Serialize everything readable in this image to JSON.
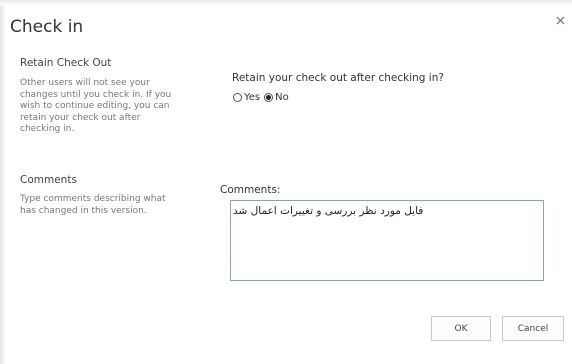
{
  "dialog": {
    "title": "Check in",
    "close_icon": "close-icon"
  },
  "retain_section": {
    "title": "Retain Check Out",
    "description_lines": [
      "Other users will not see your",
      "changes until you check in. If you",
      "wish to continue editing, you can",
      "retain your check out after",
      "checking in."
    ],
    "question": "Retain your check out after checking in?",
    "options": [
      {
        "label": "Yes",
        "selected": false
      },
      {
        "label": "No",
        "selected": true
      }
    ]
  },
  "comments_section": {
    "title": "Comments",
    "description_lines": [
      "Type comments describing what",
      "has changed in this version."
    ],
    "field_label": "Comments:",
    "value": "فایل مورد نظر بررسی و تغییرات اعمال شد"
  },
  "buttons": {
    "ok_label": "OK",
    "cancel_label": "Cancel"
  },
  "colors": {
    "input_border": "#7fa7c8"
  }
}
